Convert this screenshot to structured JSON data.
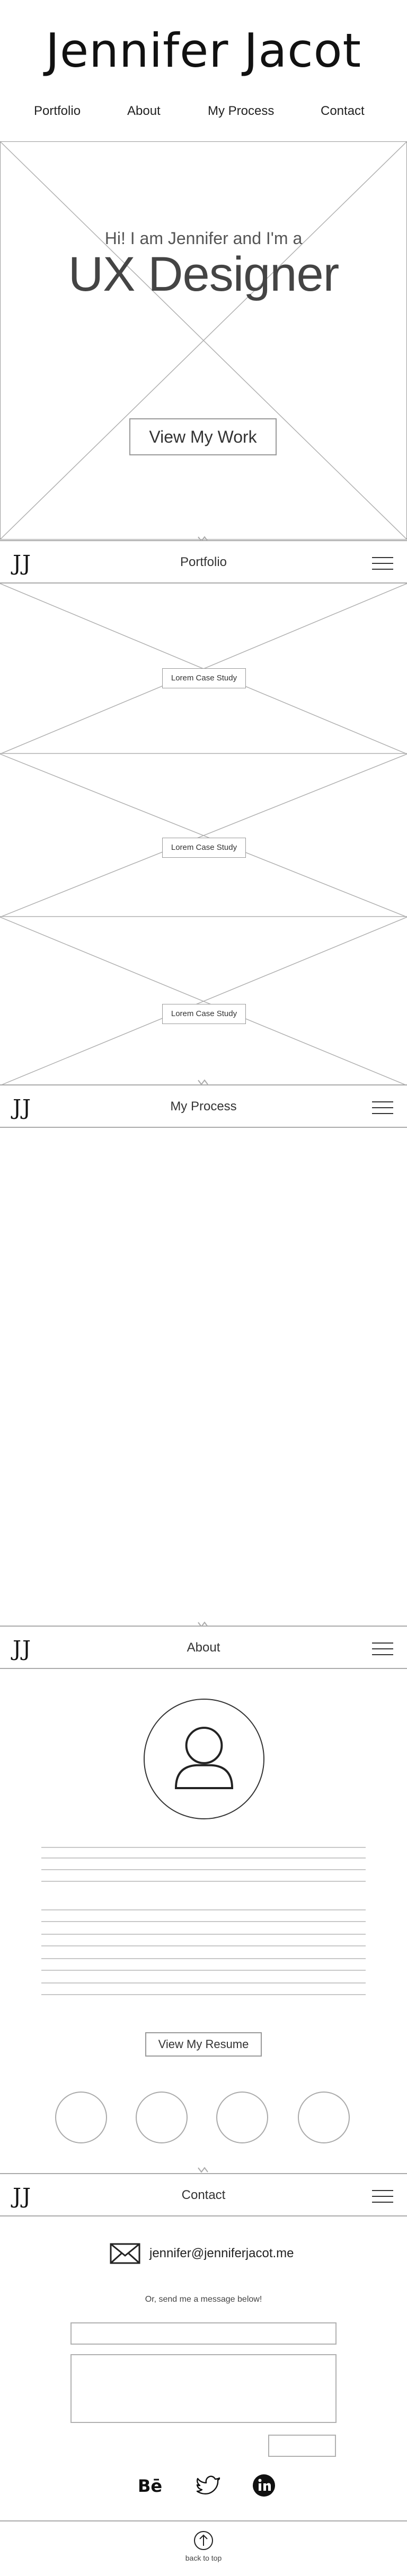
{
  "header": {
    "site_title": "Jennifer Jacot",
    "nav": [
      "Portfolio",
      "About",
      "My Process",
      "Contact"
    ]
  },
  "hero": {
    "intro": "Hi! I am Jennifer and I'm a",
    "role": "UX Designer",
    "cta": "View My Work"
  },
  "brand": {
    "logo": "JJ"
  },
  "sections": {
    "portfolio": "Portfolio",
    "process": "My Process",
    "about": "About",
    "contact": "Contact"
  },
  "portfolio": {
    "case_studies": [
      "Lorem Case Study",
      "Lorem Case Study",
      "Lorem Case Study"
    ]
  },
  "about": {
    "resume_button": "View My Resume"
  },
  "contact": {
    "email": "jennifer@jenniferjacot.me",
    "prompt": "Or, send me a message below!"
  },
  "footer": {
    "back_to_top": "back to top",
    "social": [
      "behance-icon",
      "twitter-icon",
      "linkedin-icon"
    ]
  },
  "colors": {
    "wireframe_line": "#9a9a9a",
    "text": "#222222"
  }
}
